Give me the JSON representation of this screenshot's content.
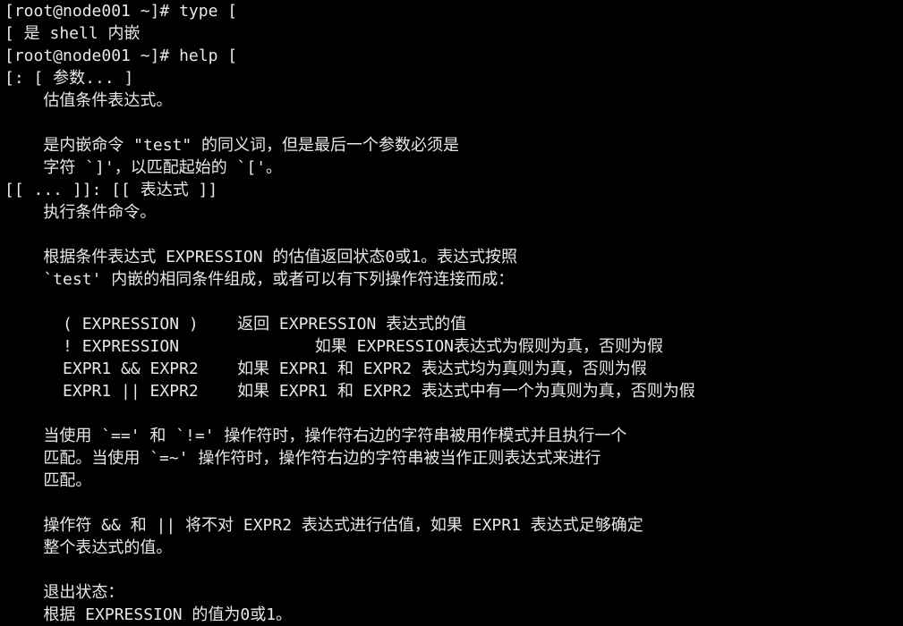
{
  "terminal": {
    "lines": [
      "[root@node001 ~]# type [",
      "[ 是 shell 内嵌",
      "[root@node001 ~]# help [",
      "[: [ 参数... ]",
      "    估值条件表达式。",
      "",
      "    是内嵌命令 \"test\" 的同义词，但是最后一个参数必须是",
      "    字符 `]'，以匹配起始的 `['。",
      "[[ ... ]]: [[ 表达式 ]]",
      "    执行条件命令。",
      "",
      "    根据条件表达式 EXPRESSION 的估值返回状态0或1。表达式按照",
      "    `test' 内嵌的相同条件组成，或者可以有下列操作符连接而成：",
      "",
      "      ( EXPRESSION )    返回 EXPRESSION 表达式的值",
      "      ! EXPRESSION              如果 EXPRESSION表达式为假则为真，否则为假",
      "      EXPR1 && EXPR2    如果 EXPR1 和 EXPR2 表达式均为真则为真，否则为假",
      "      EXPR1 || EXPR2    如果 EXPR1 和 EXPR2 表达式中有一个为真则为真，否则为假",
      "",
      "    当使用 `==' 和 `!=' 操作符时，操作符右边的字符串被用作模式并且执行一个",
      "    匹配。当使用 `=~' 操作符时，操作符右边的字符串被当作正则表达式来进行",
      "    匹配。",
      "",
      "    操作符 && 和 || 将不对 EXPR2 表达式进行估值，如果 EXPR1 表达式足够确定",
      "    整个表达式的值。",
      "",
      "    退出状态：",
      "    根据 EXPRESSION 的值为0或1。"
    ]
  },
  "colors": {
    "background": "#000000",
    "foreground": "#e8e8e8"
  }
}
